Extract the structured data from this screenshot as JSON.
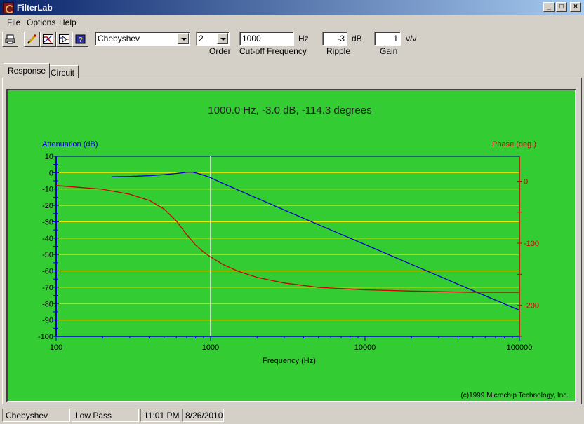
{
  "window": {
    "title": "FilterLab"
  },
  "menu": [
    "File",
    "Options",
    "Help"
  ],
  "toolbar": {
    "filter_type": "Chebyshev",
    "order": {
      "value": "2",
      "label": "Order"
    },
    "cutoff": {
      "value": "1000",
      "unit": "Hz",
      "label": "Cut-off Frequency"
    },
    "ripple": {
      "value": "-3",
      "unit": "dB",
      "label": "Ripple"
    },
    "gain": {
      "value": "1",
      "unit": "v/v",
      "label": "Gain"
    }
  },
  "tabs": [
    "Response",
    "Circuit"
  ],
  "status": {
    "filter": "Chebyshev",
    "band": "Low Pass",
    "time": "11:01 PM",
    "date": "8/26/2010"
  },
  "colors": {
    "plot_bg": "#33cc33",
    "attenuation": "#0000cc",
    "phase": "#cc0000",
    "grid": "#e8e800",
    "cursor": "#ffffff"
  },
  "chart_data": {
    "type": "line",
    "title": "1000.0 Hz, -3.0 dB, -114.3 degrees",
    "xlabel": "Frequency (Hz)",
    "ylabel": "Attenuation (dB)",
    "y2label": "Phase (deg.)",
    "copyright": "(c)1999 Microchip Technology, Inc.",
    "x_scale": "log",
    "xlim": [
      100,
      100000
    ],
    "ylim": [
      -100,
      10
    ],
    "y2lim": [
      -250,
      40
    ],
    "x_ticks": [
      "100",
      "1000",
      "10000",
      "100000"
    ],
    "y_ticks": [
      "10",
      "0",
      "-10",
      "-20",
      "-30",
      "-40",
      "-50",
      "-60",
      "-70",
      "-80",
      "-90",
      "-100"
    ],
    "y2_ticks": [
      "0",
      "-100",
      "-200"
    ],
    "cursor_x": 1000,
    "grid": true,
    "series": [
      {
        "axis": "left",
        "x": [
          230,
          300,
          400,
          500,
          600,
          700,
          760,
          820,
          900,
          1000,
          1200,
          1500,
          2000,
          3000,
          5000,
          10000,
          20000,
          50000,
          100000
        ],
        "y": [
          -2.5,
          -2.3,
          -1.8,
          -1.2,
          -0.5,
          0.2,
          0.3,
          -0.3,
          -1.5,
          -3.0,
          -6.5,
          -10.5,
          -15.6,
          -22.8,
          -31.8,
          -43.9,
          -56.0,
          -72.0,
          -84.0
        ]
      },
      {
        "axis": "right",
        "x": [
          100,
          200,
          300,
          400,
          500,
          600,
          700,
          800,
          900,
          1000,
          1200,
          1500,
          2000,
          3000,
          5000,
          10000,
          20000,
          50000,
          100000
        ],
        "y": [
          -7,
          -13,
          -21,
          -31,
          -45,
          -64,
          -86,
          -103,
          -114,
          -122,
          -134,
          -145,
          -155,
          -164,
          -171,
          -175,
          -177,
          -179,
          -179
        ]
      }
    ]
  }
}
